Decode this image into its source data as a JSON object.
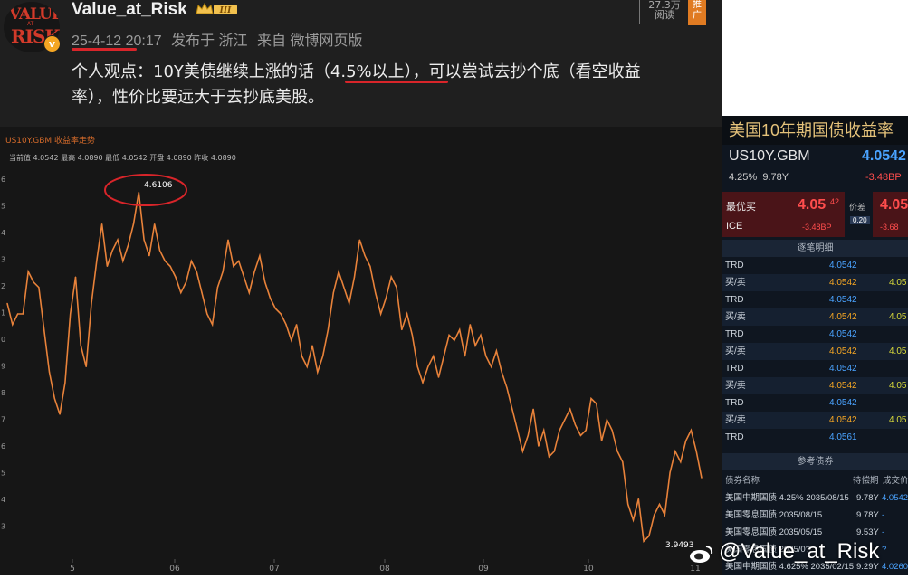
{
  "post": {
    "avatar": {
      "line1": "VALUE",
      "line2": "AT",
      "line3": "RISK"
    },
    "verified_mark": "v",
    "username": "Value_at_Risk",
    "level_badge": "III",
    "date": "25-4-12 20:17",
    "posted_from": "发布于 浙江",
    "via": "来自 微博网页版",
    "reads_count": "27.3万",
    "reads_label": "阅读",
    "ad_label_1": "推",
    "ad_label_2": "广",
    "text_line1": "个人观点：10Y美债继续上涨的话（4.5%以上），可以尝试去抄个底（看空收益",
    "text_line2": "率），性价比要远大于去抄底美股。"
  },
  "chart": {
    "title": "US10Y.GBM 收益率走势",
    "stats": "当前值 4.0542 最高 4.0890 最低 4.0542 开盘 4.0890 昨收 4.0890",
    "peak_label": "4.6106",
    "trough_label": "3.9493",
    "ytick_labels": [
      "6",
      "5",
      "4",
      "3",
      "2",
      "1",
      "0",
      "9",
      "8",
      "7",
      "6",
      "5",
      "4",
      "3"
    ],
    "xtick_labels": [
      "5",
      "06",
      "07",
      "08",
      "09",
      "10",
      "11"
    ],
    "line_color": "#e8823a"
  },
  "chart_data": {
    "type": "line",
    "title": "",
    "xlabel": "",
    "ylabel": "",
    "categories": [
      "05",
      "06",
      "07",
      "08",
      "09",
      "10",
      "11"
    ],
    "series": [
      {
        "values": [
          4.4,
          4.36,
          4.38,
          4.38,
          4.46,
          4.44,
          4.43,
          4.35,
          4.27,
          4.22,
          4.19,
          4.25,
          4.38,
          4.45,
          4.32,
          4.28,
          4.4,
          4.48,
          4.55,
          4.47,
          4.5,
          4.52,
          4.48,
          4.51,
          4.55,
          4.61,
          4.52,
          4.49,
          4.55,
          4.5,
          4.48,
          4.47,
          4.45,
          4.42,
          4.44,
          4.48,
          4.46,
          4.42,
          4.38,
          4.36,
          4.43,
          4.46,
          4.52,
          4.47,
          4.48,
          4.45,
          4.42,
          4.46,
          4.49,
          4.44,
          4.41,
          4.39,
          4.38,
          4.36,
          4.33,
          4.36,
          4.3,
          4.28,
          4.32,
          4.27,
          4.3,
          4.35,
          4.42,
          4.46,
          4.43,
          4.4,
          4.45,
          4.52,
          4.49,
          4.47,
          4.42,
          4.38,
          4.41,
          4.45,
          4.43,
          4.35,
          4.38,
          4.34,
          4.28,
          4.25,
          4.28,
          4.3,
          4.26,
          4.3,
          4.34,
          4.33,
          4.35,
          4.3,
          4.36,
          4.32,
          4.34,
          4.3,
          4.28,
          4.31,
          4.27,
          4.24,
          4.2,
          4.16,
          4.12,
          4.15,
          4.2,
          4.13,
          4.16,
          4.11,
          4.12,
          4.16,
          4.18,
          4.2,
          4.17,
          4.15,
          4.16,
          4.22,
          4.21,
          4.14,
          4.18,
          4.16,
          4.12,
          4.1,
          4.02,
          3.99,
          4.03,
          3.95,
          3.96,
          4.0,
          4.02,
          4.0,
          4.08,
          4.12,
          4.1,
          4.14,
          4.16,
          4.12,
          4.07
        ]
      }
    ],
    "peak": 4.6106,
    "trough": 3.9493
  },
  "panel": {
    "title": "美国10年期国债收益率",
    "symbol": "US10Y.GBM",
    "value": "4.0542",
    "coupon": "4.25%",
    "maturity": "9.78Y",
    "change": "-3.48BP",
    "best_bid_label": "最优买",
    "best_bid_value": "4.05",
    "best_bid_sup": "42",
    "best_bid_source": "ICE",
    "best_bid_change": "-3.48BP",
    "spread_label": "价差",
    "spread_value": "0.20",
    "best_ask_value": "4.05",
    "best_ask_change": "-3.68",
    "trades_header": "逐笔明细",
    "trades": [
      {
        "type": "TRD",
        "price": "4.0542",
        "price_color": "blue",
        "extra": ""
      },
      {
        "type": "买/卖",
        "price": "4.0542",
        "price_color": "orange",
        "extra": "4.05"
      },
      {
        "type": "TRD",
        "price": "4.0542",
        "price_color": "blue",
        "extra": ""
      },
      {
        "type": "买/卖",
        "price": "4.0542",
        "price_color": "orange",
        "extra": "4.05"
      },
      {
        "type": "TRD",
        "price": "4.0542",
        "price_color": "blue",
        "extra": ""
      },
      {
        "type": "买/卖",
        "price": "4.0542",
        "price_color": "orange",
        "extra": "4.05"
      },
      {
        "type": "TRD",
        "price": "4.0542",
        "price_color": "blue",
        "extra": ""
      },
      {
        "type": "买/卖",
        "price": "4.0542",
        "price_color": "orange",
        "extra": "4.05"
      },
      {
        "type": "TRD",
        "price": "4.0542",
        "price_color": "blue",
        "extra": ""
      },
      {
        "type": "买/卖",
        "price": "4.0542",
        "price_color": "orange",
        "extra": "4.05"
      },
      {
        "type": "TRD",
        "price": "4.0561",
        "price_color": "blue",
        "extra": ""
      }
    ],
    "ref_header": "参考债券",
    "bond_cols": [
      "债券名称",
      "待偿期",
      "成交价"
    ],
    "bonds": [
      {
        "name": "美国中期国债 4.25% 2035/08/15",
        "term": "9.78Y",
        "price": "4.0542"
      },
      {
        "name": "美国零息国债 2035/08/15",
        "term": "9.78Y",
        "price": "-"
      },
      {
        "name": "美国零息国债 2035/05/15",
        "term": "9.53Y",
        "price": "-"
      },
      {
        "name": "美国零息国债 2035/0?",
        "term": "",
        "price": "?"
      },
      {
        "name": "美国中期国债 4.625% 2035/02/15",
        "term": "9.29Y",
        "price": "4.0260"
      }
    ]
  },
  "watermark": "@Value_at_Risk"
}
